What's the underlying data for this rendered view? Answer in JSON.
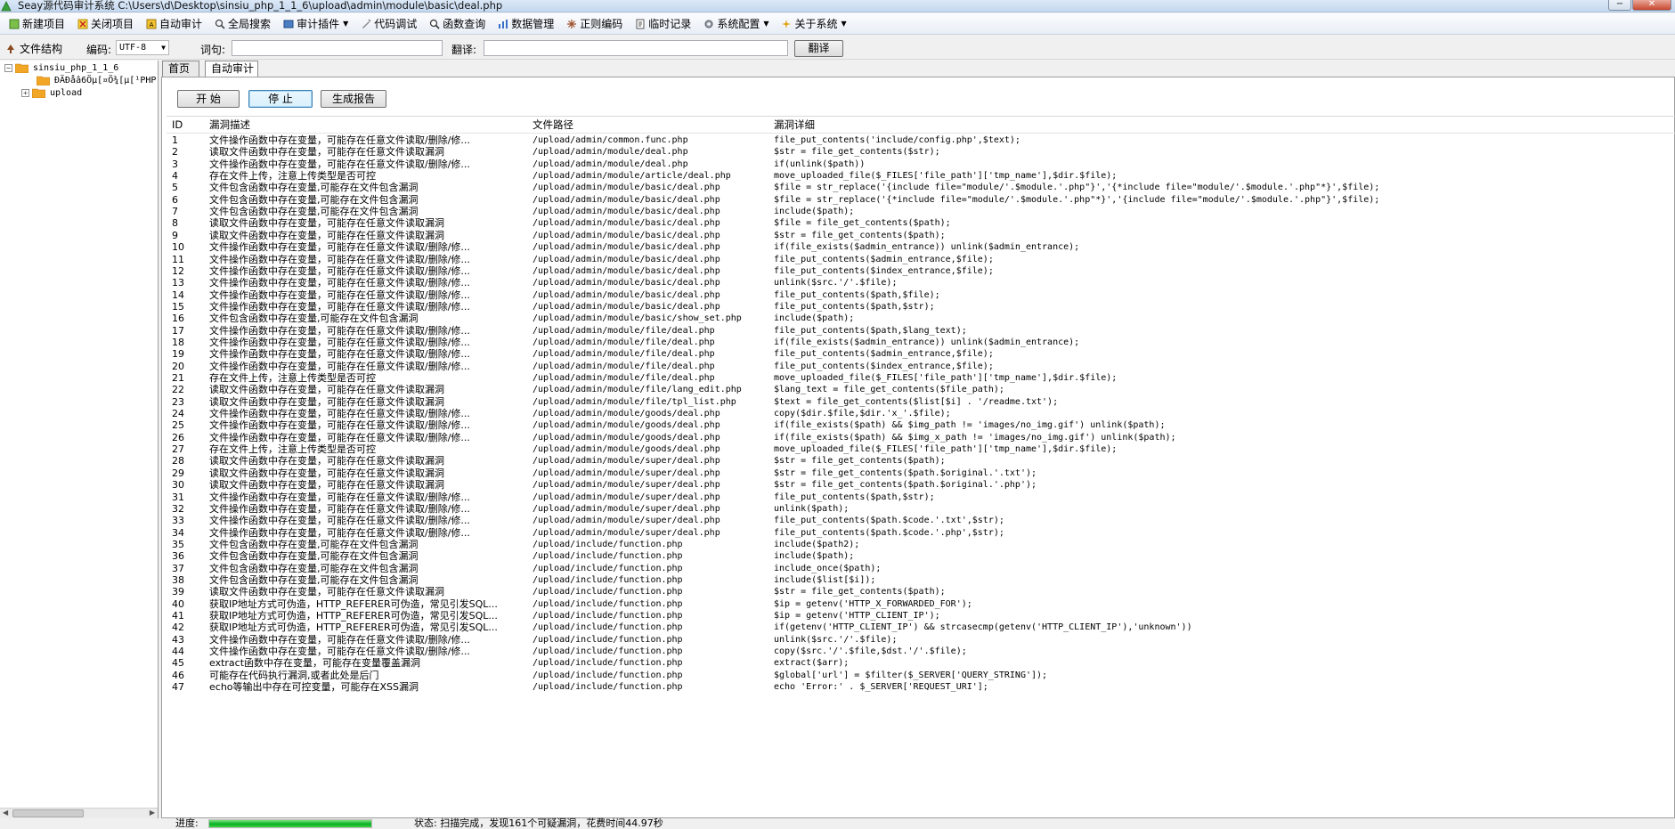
{
  "window": {
    "title": "Seay源代码审计系统   C:\\Users\\d\\Desktop\\sinsiu_php_1_1_6\\upload\\admin\\module\\basic\\deal.php",
    "minimize_glyph": "−",
    "close_glyph": "✕"
  },
  "menu": [
    {
      "key": "new",
      "label": "新建项目",
      "icon": "new-project-icon",
      "dropdown": false
    },
    {
      "key": "close",
      "label": "关闭项目",
      "icon": "close-project-icon",
      "dropdown": false
    },
    {
      "key": "audit",
      "label": "自动审计",
      "icon": "auto-audit-icon",
      "dropdown": false
    },
    {
      "key": "search",
      "label": "全局搜索",
      "icon": "search-icon",
      "dropdown": false
    },
    {
      "key": "plugin",
      "label": "审计插件",
      "icon": "plugin-icon",
      "dropdown": true
    },
    {
      "key": "debug",
      "label": "代码调试",
      "icon": "debug-icon",
      "dropdown": false
    },
    {
      "key": "func",
      "label": "函数查询",
      "icon": "function-search-icon",
      "dropdown": false
    },
    {
      "key": "data",
      "label": "数据管理",
      "icon": "data-icon",
      "dropdown": false
    },
    {
      "key": "regex",
      "label": "正则编码",
      "icon": "regex-icon",
      "dropdown": false
    },
    {
      "key": "temp",
      "label": "临时记录",
      "icon": "notes-icon",
      "dropdown": false
    },
    {
      "key": "config",
      "label": "系统配置",
      "icon": "gear-icon",
      "dropdown": true
    },
    {
      "key": "about",
      "label": "关于系统",
      "icon": "about-icon",
      "dropdown": true
    }
  ],
  "toolbar": {
    "file_tree_label": "文件结构",
    "encoding_label": "编码:",
    "encoding_value": "UTF-8",
    "word_label": "词句:",
    "word_value": "",
    "translate_label": "翻译:",
    "translate_value": "",
    "translate_button": "翻译"
  },
  "tree": {
    "root": "sinsiu_php_1_1_6",
    "children": [
      "ÐÄÐåâ6Öµ[¤Ö¾[µ[¹PHP",
      "upload"
    ]
  },
  "tabs": [
    {
      "label": "首页",
      "active": false
    },
    {
      "label": "自动审计",
      "active": true
    }
  ],
  "actions": {
    "start": "开  始",
    "stop": "停  止",
    "report": "生成报告"
  },
  "table": {
    "columns": [
      "ID",
      "漏洞描述",
      "文件路径",
      "漏洞详细"
    ],
    "rows": [
      [
        "1",
        "文件操作函数中存在变量，可能存在任意文件读取/删除/修...",
        "/upload/admin/common.func.php",
        "file_put_contents('include/config.php',$text);"
      ],
      [
        "2",
        "读取文件函数中存在变量，可能存在任意文件读取漏洞",
        "/upload/admin/module/deal.php",
        "$str = file_get_contents($str);"
      ],
      [
        "3",
        "文件操作函数中存在变量，可能存在任意文件读取/删除/修...",
        "/upload/admin/module/deal.php",
        "if(unlink($path))"
      ],
      [
        "4",
        "存在文件上传，注意上传类型是否可控",
        "/upload/admin/module/article/deal.php",
        "move_uploaded_file($_FILES['file_path']['tmp_name'],$dir.$file);"
      ],
      [
        "5",
        "文件包含函数中存在变量,可能存在文件包含漏洞",
        "/upload/admin/module/basic/deal.php",
        "$file = str_replace('{include file=\"module/'.$module.'.php\"}','{*include file=\"module/'.$module.'.php\"*}',$file);"
      ],
      [
        "6",
        "文件包含函数中存在变量,可能存在文件包含漏洞",
        "/upload/admin/module/basic/deal.php",
        "$file = str_replace('{*include file=\"module/'.$module.'.php\"*}','{include file=\"module/'.$module.'.php\"}',$file);"
      ],
      [
        "7",
        "文件包含函数中存在变量,可能存在文件包含漏洞",
        "/upload/admin/module/basic/deal.php",
        "include($path);"
      ],
      [
        "8",
        "读取文件函数中存在变量，可能存在任意文件读取漏洞",
        "/upload/admin/module/basic/deal.php",
        "$file = file_get_contents($path);"
      ],
      [
        "9",
        "读取文件函数中存在变量，可能存在任意文件读取漏洞",
        "/upload/admin/module/basic/deal.php",
        "$str = file_get_contents($path);"
      ],
      [
        "10",
        "文件操作函数中存在变量，可能存在任意文件读取/删除/修...",
        "/upload/admin/module/basic/deal.php",
        "if(file_exists($admin_entrance)) unlink($admin_entrance);"
      ],
      [
        "11",
        "文件操作函数中存在变量，可能存在任意文件读取/删除/修...",
        "/upload/admin/module/basic/deal.php",
        "file_put_contents($admin_entrance,$file);"
      ],
      [
        "12",
        "文件操作函数中存在变量，可能存在任意文件读取/删除/修...",
        "/upload/admin/module/basic/deal.php",
        "file_put_contents($index_entrance,$file);"
      ],
      [
        "13",
        "文件操作函数中存在变量，可能存在任意文件读取/删除/修...",
        "/upload/admin/module/basic/deal.php",
        "unlink($src.'/'.$file);"
      ],
      [
        "14",
        "文件操作函数中存在变量，可能存在任意文件读取/删除/修...",
        "/upload/admin/module/basic/deal.php",
        "file_put_contents($path,$file);"
      ],
      [
        "15",
        "文件操作函数中存在变量，可能存在任意文件读取/删除/修...",
        "/upload/admin/module/basic/deal.php",
        "file_put_contents($path,$str);"
      ],
      [
        "16",
        "文件包含函数中存在变量,可能存在文件包含漏洞",
        "/upload/admin/module/basic/show_set.php",
        "include($path);"
      ],
      [
        "17",
        "文件操作函数中存在变量，可能存在任意文件读取/删除/修...",
        "/upload/admin/module/file/deal.php",
        "file_put_contents($path,$lang_text);"
      ],
      [
        "18",
        "文件操作函数中存在变量，可能存在任意文件读取/删除/修...",
        "/upload/admin/module/file/deal.php",
        "if(file_exists($admin_entrance)) unlink($admin_entrance);"
      ],
      [
        "19",
        "文件操作函数中存在变量，可能存在任意文件读取/删除/修...",
        "/upload/admin/module/file/deal.php",
        "file_put_contents($admin_entrance,$file);"
      ],
      [
        "20",
        "文件操作函数中存在变量，可能存在任意文件读取/删除/修...",
        "/upload/admin/module/file/deal.php",
        "file_put_contents($index_entrance,$file);"
      ],
      [
        "21",
        "存在文件上传，注意上传类型是否可控",
        "/upload/admin/module/file/deal.php",
        "move_uploaded_file($_FILES['file_path']['tmp_name'],$dir.$file);"
      ],
      [
        "22",
        "读取文件函数中存在变量，可能存在任意文件读取漏洞",
        "/upload/admin/module/file/lang_edit.php",
        "$lang_text = file_get_contents($file_path);"
      ],
      [
        "23",
        "读取文件函数中存在变量，可能存在任意文件读取漏洞",
        "/upload/admin/module/file/tpl_list.php",
        "$text = file_get_contents($list[$i] . '/readme.txt');"
      ],
      [
        "24",
        "文件操作函数中存在变量，可能存在任意文件读取/删除/修...",
        "/upload/admin/module/goods/deal.php",
        "copy($dir.$file,$dir.'x_'.$file);"
      ],
      [
        "25",
        "文件操作函数中存在变量，可能存在任意文件读取/删除/修...",
        "/upload/admin/module/goods/deal.php",
        "if(file_exists($path) && $img_path != 'images/no_img.gif') unlink($path);"
      ],
      [
        "26",
        "文件操作函数中存在变量，可能存在任意文件读取/删除/修...",
        "/upload/admin/module/goods/deal.php",
        "if(file_exists($path) && $img_x_path != 'images/no_img.gif') unlink($path);"
      ],
      [
        "27",
        "存在文件上传，注意上传类型是否可控",
        "/upload/admin/module/goods/deal.php",
        "move_uploaded_file($_FILES['file_path']['tmp_name'],$dir.$file);"
      ],
      [
        "28",
        "读取文件函数中存在变量，可能存在任意文件读取漏洞",
        "/upload/admin/module/super/deal.php",
        "$str = file_get_contents($path);"
      ],
      [
        "29",
        "读取文件函数中存在变量，可能存在任意文件读取漏洞",
        "/upload/admin/module/super/deal.php",
        "$str = file_get_contents($path.$original.'.txt');"
      ],
      [
        "30",
        "读取文件函数中存在变量，可能存在任意文件读取漏洞",
        "/upload/admin/module/super/deal.php",
        "$str = file_get_contents($path.$original.'.php');"
      ],
      [
        "31",
        "文件操作函数中存在变量，可能存在任意文件读取/删除/修...",
        "/upload/admin/module/super/deal.php",
        "file_put_contents($path,$str);"
      ],
      [
        "32",
        "文件操作函数中存在变量，可能存在任意文件读取/删除/修...",
        "/upload/admin/module/super/deal.php",
        "unlink($path);"
      ],
      [
        "33",
        "文件操作函数中存在变量，可能存在任意文件读取/删除/修...",
        "/upload/admin/module/super/deal.php",
        "file_put_contents($path.$code.'.txt',$str);"
      ],
      [
        "34",
        "文件操作函数中存在变量，可能存在任意文件读取/删除/修...",
        "/upload/admin/module/super/deal.php",
        "file_put_contents($path.$code.'.php',$str);"
      ],
      [
        "35",
        "文件包含函数中存在变量,可能存在文件包含漏洞",
        "/upload/include/function.php",
        "include($path2);"
      ],
      [
        "36",
        "文件包含函数中存在变量,可能存在文件包含漏洞",
        "/upload/include/function.php",
        "include($path);"
      ],
      [
        "37",
        "文件包含函数中存在变量,可能存在文件包含漏洞",
        "/upload/include/function.php",
        "include_once($path);"
      ],
      [
        "38",
        "文件包含函数中存在变量,可能存在文件包含漏洞",
        "/upload/include/function.php",
        "include($list[$i]);"
      ],
      [
        "39",
        "读取文件函数中存在变量，可能存在任意文件读取漏洞",
        "/upload/include/function.php",
        "$str = file_get_contents($path);"
      ],
      [
        "40",
        "获取IP地址方式可伪造，HTTP_REFERER可伪造，常见引发SQL...",
        "/upload/include/function.php",
        "$ip = getenv('HTTP_X_FORWARDED_FOR');"
      ],
      [
        "41",
        "获取IP地址方式可伪造，HTTP_REFERER可伪造，常见引发SQL...",
        "/upload/include/function.php",
        "$ip = getenv('HTTP_CLIENT_IP');"
      ],
      [
        "42",
        "获取IP地址方式可伪造，HTTP_REFERER可伪造，常见引发SQL...",
        "/upload/include/function.php",
        "if(getenv('HTTP_CLIENT_IP') && strcasecmp(getenv('HTTP_CLIENT_IP'),'unknown'))"
      ],
      [
        "43",
        "文件操作函数中存在变量，可能存在任意文件读取/删除/修...",
        "/upload/include/function.php",
        "unlink($src.'/'.$file);"
      ],
      [
        "44",
        "文件操作函数中存在变量，可能存在任意文件读取/删除/修...",
        "/upload/include/function.php",
        "copy($src.'/'.$file,$dst.'/'.$file);"
      ],
      [
        "45",
        "extract函数中存在变量，可能存在变量覆盖漏洞",
        "/upload/include/function.php",
        "extract($arr);"
      ],
      [
        "46",
        "可能存在代码执行漏洞,或者此处是后门",
        "/upload/include/function.php",
        "$global['url'] = $filter($_SERVER['QUERY_STRING']);"
      ],
      [
        "47",
        "echo等输出中存在可控变量，可能存在XSS漏洞",
        "/upload/include/function.php",
        "echo 'Error:' . $_SERVER['REQUEST_URI'];"
      ]
    ]
  },
  "status": {
    "progress_label": "进度:",
    "progress_fraction": 1.0,
    "text": "状态: 扫描完成，发现161个可疑漏洞，花费时间44.97秒"
  }
}
